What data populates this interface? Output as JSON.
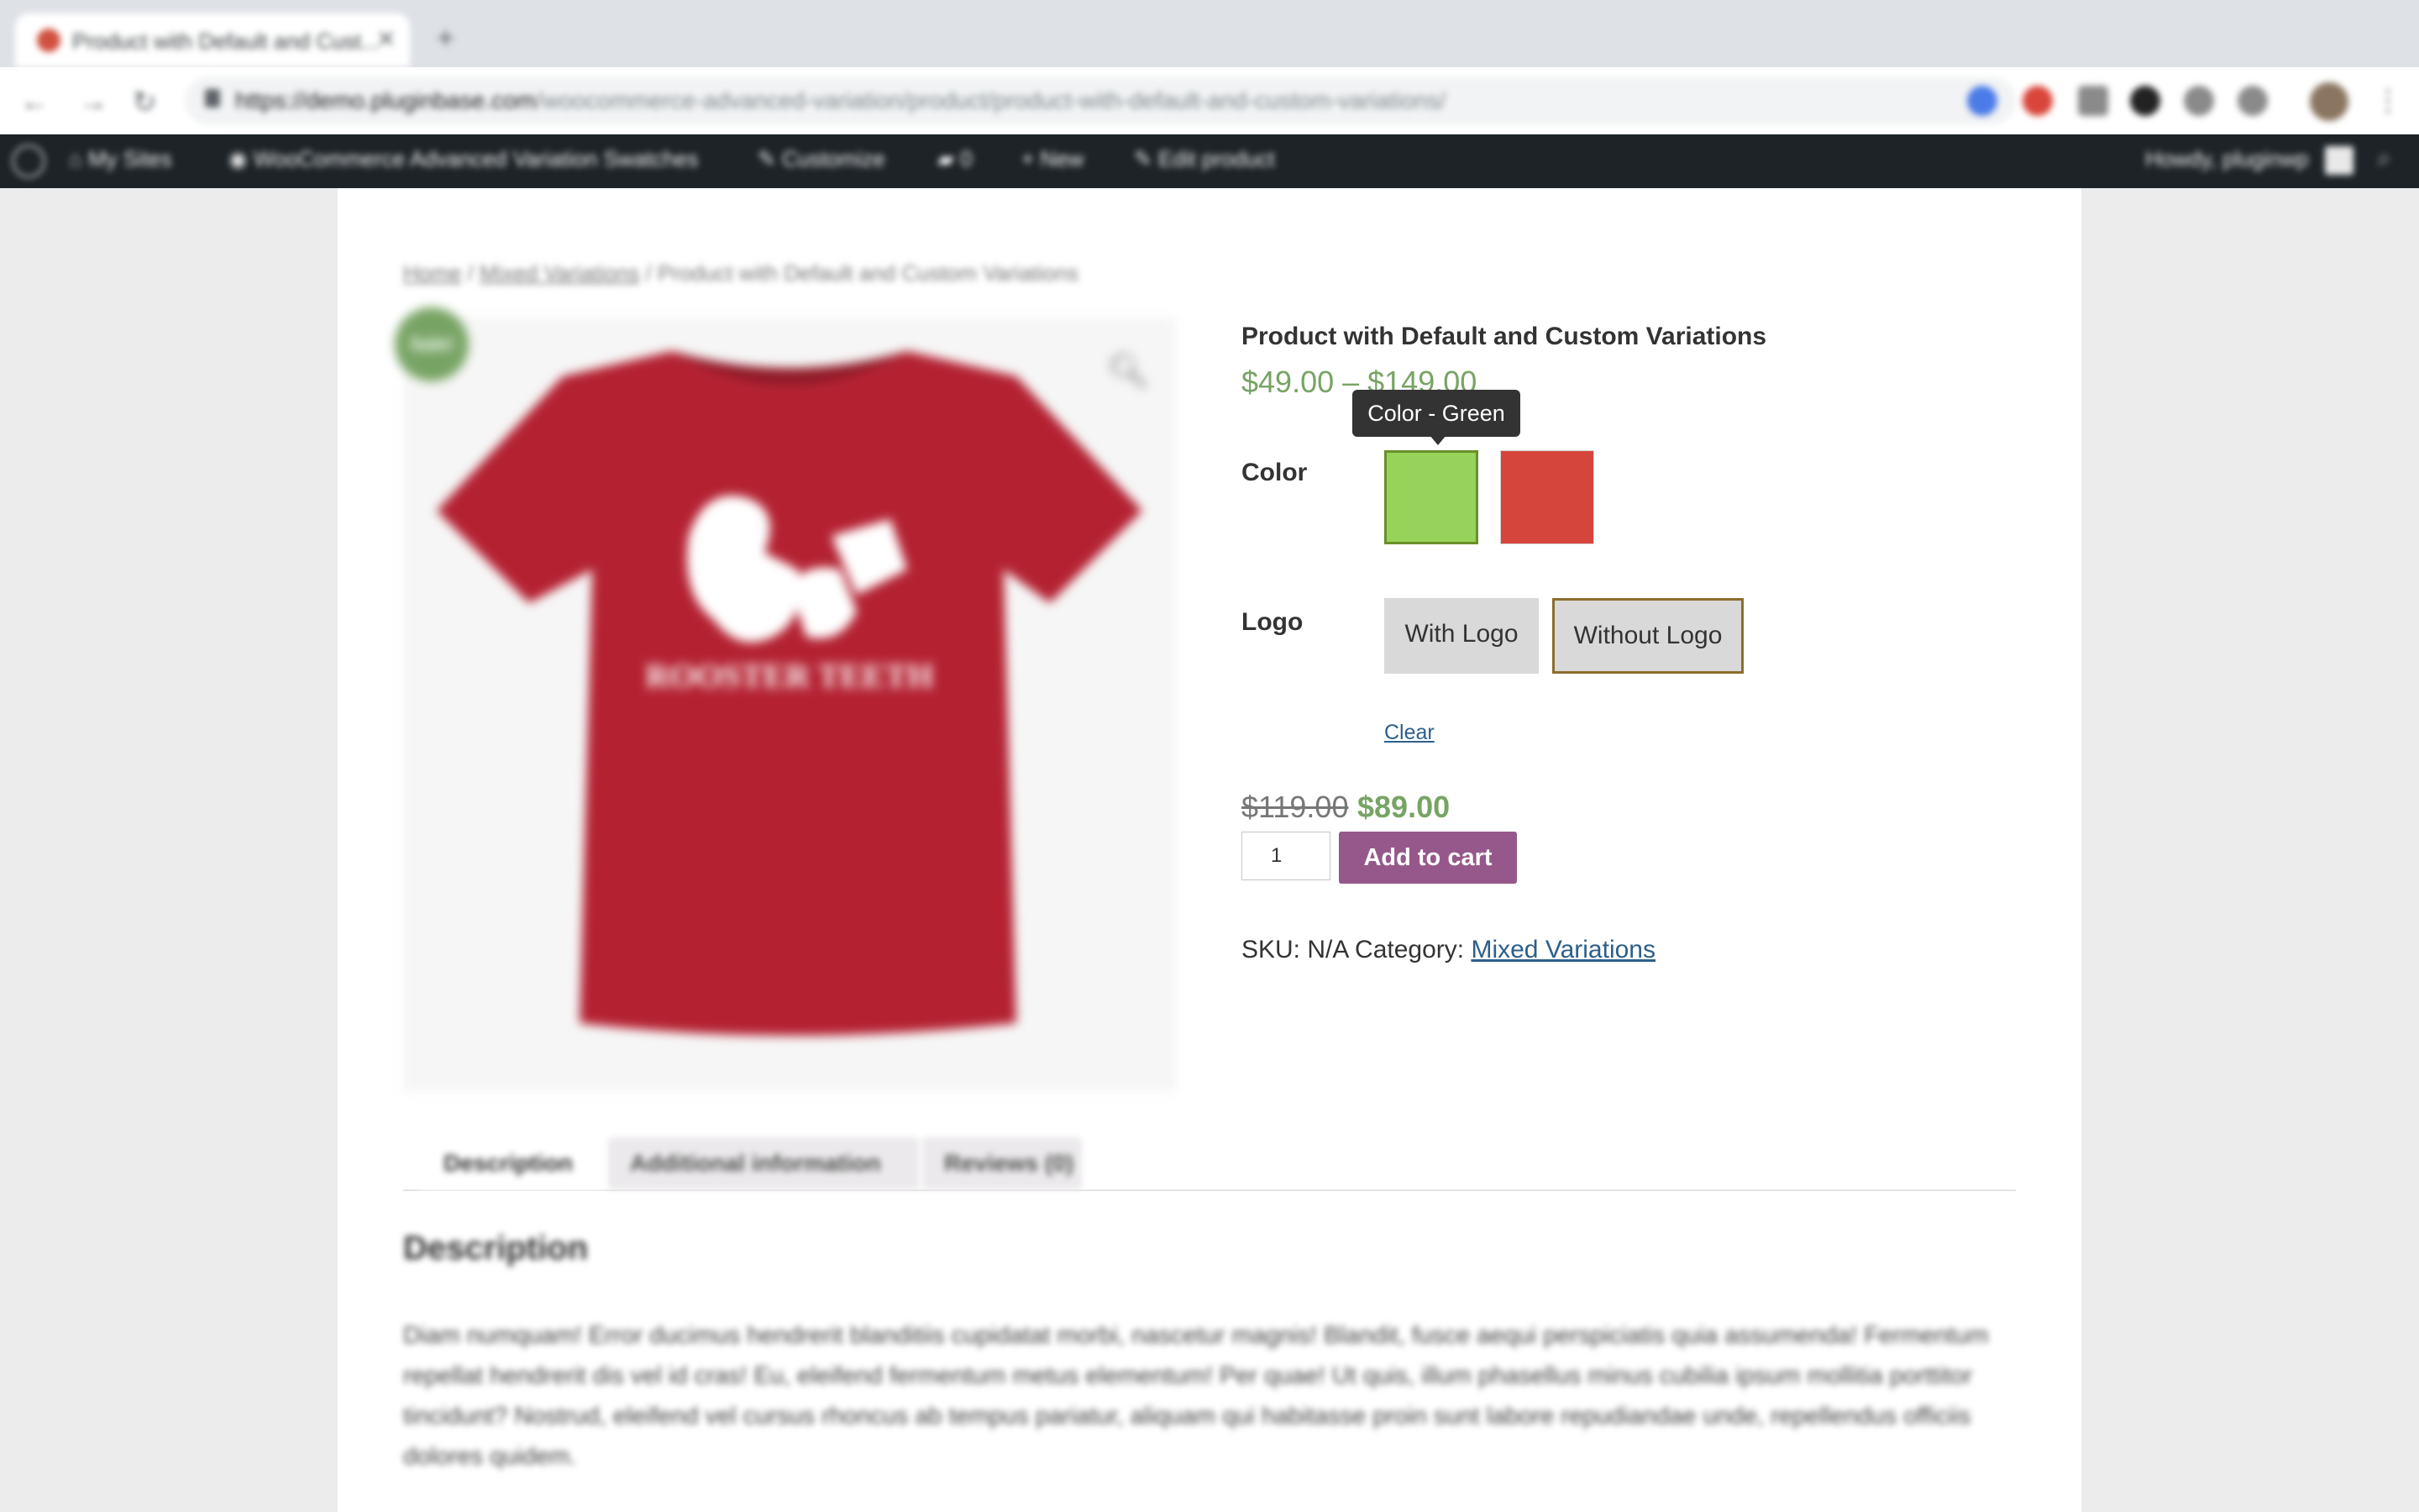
{
  "browser": {
    "tab_title": "Product with Default and Cust...",
    "url_domain": "https://demo.pluginbase.com",
    "url_path": "/woocommerce-advanced-variation/product/product-with-default-and-custom-variations/"
  },
  "admin_bar": {
    "my_sites": "My Sites",
    "site_name": "WooCommerce Advanced Variation Swatches",
    "customize": "Customize",
    "comments_count": "0",
    "new": "New",
    "edit_product": "Edit product",
    "howdy": "Howdy, pluginwp"
  },
  "breadcrumb": {
    "home": "Home",
    "sep1": " / ",
    "category": "Mixed Variations",
    "sep2": " / ",
    "current": "Product with Default and Custom Variations"
  },
  "product": {
    "sale_badge": "Sale!",
    "title": "Product with Default and Custom Variations",
    "price_range": "$49.00 – $149.00",
    "tooltip": "Color - Green",
    "color_label": "Color",
    "colors": [
      {
        "name": "Green",
        "hex": "#97d35b"
      },
      {
        "name": "Red",
        "hex": "#d5453b"
      }
    ],
    "logo_label": "Logo",
    "logo_options": [
      "With Logo",
      "Without Logo"
    ],
    "clear": "Clear",
    "price_old": "$119.00",
    "price_new": "$89.00",
    "quantity": "1",
    "add_to_cart": "Add to cart",
    "sku_label": "SKU: N/A Category: ",
    "category_link": "Mixed Variations",
    "shirt_text": "ROOSTER TEETH",
    "shirt_color": "#b42232"
  },
  "tabs": [
    "Description",
    "Additional information",
    "Reviews (0)"
  ],
  "description": {
    "heading": "Description",
    "text": "Diam numquam! Error ducimus hendrerit blanditiis cupidatat morbi, nascetur magnis! Blandit, fusce aequi perspiciatis quia assumenda! Fermentum repellat hendrerit dis vel id cras! Eu, eleifend fermentum metus elementum! Per quae! Ut quis, illum phasellus minus cubilia ipsum mollitia porttitor tincidunt? Nostrud, eleifend vel cursus rhoncus ab tempus pariatur, aliquam qui habitasse proin sunt labore repudiandae unde, repellendus officiis dolores quidem."
  }
}
